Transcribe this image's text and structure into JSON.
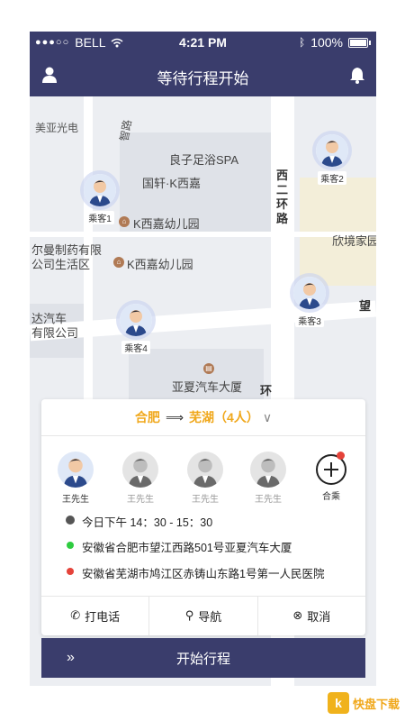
{
  "status_bar": {
    "carrier": "BELL",
    "time": "4:21 PM",
    "battery": "100%"
  },
  "header": {
    "title": "等待行程开始"
  },
  "map": {
    "labels": {
      "meiya": "美亚光电",
      "liangzi": "良子足浴SPA",
      "guoxuan": "国轩·K西嘉",
      "kxijia1": "K西嘉幼儿园",
      "kxijia2": "K西嘉幼儿园",
      "pharma1": "尔曼制药有限",
      "pharma2": "公司生活区",
      "xinhao": "欣境家园",
      "daqi1": "达汽车",
      "daqi2": "有限公司",
      "yaxia": "亚夏汽车大厦",
      "road_xi": "西二环路",
      "road_zhi": "智路",
      "road_huan": "环",
      "road_wang": "望"
    },
    "passengers": [
      "乘客1",
      "乘客2",
      "乘客3",
      "乘客4"
    ]
  },
  "card": {
    "from": "合肥",
    "to": "芜湖（4人）",
    "passengers": [
      {
        "name": "王先生",
        "active": true
      },
      {
        "name": "王先生",
        "active": false
      },
      {
        "name": "王先生",
        "active": false
      },
      {
        "name": "王先生",
        "active": false
      }
    ],
    "carpool_label": "合乘",
    "time": "今日下午  14：30 - 15：30",
    "start_address": "安徽省合肥市望江西路501号亚夏汽车大厦",
    "end_address": "安徽省芜湖市鸠江区赤铸山东路1号第一人民医院",
    "actions": {
      "call": "打电话",
      "navigate": "导航",
      "cancel": "取消"
    }
  },
  "start_button": "开始行程",
  "colors": {
    "primary": "#3a3d6c",
    "accent": "#f0a81c",
    "start_dot": "#2ecc40",
    "end_dot": "#e5433a"
  },
  "watermark": {
    "logo_char": "k",
    "text": "快盘下载"
  }
}
